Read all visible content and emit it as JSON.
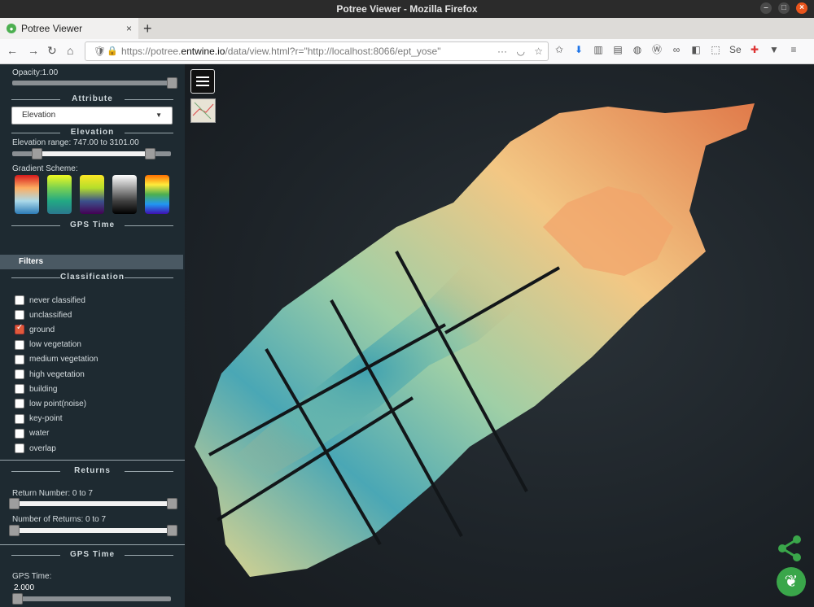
{
  "window": {
    "title": "Potree Viewer - Mozilla Firefox"
  },
  "tab": {
    "label": "Potree Viewer"
  },
  "url": {
    "prefix": "https://potree.",
    "domain": "entwine.io",
    "rest": "/data/view.html?r=\"http://localhost:8066/ept_yose\""
  },
  "sidebar": {
    "opacity_label": "Opacity:1.00",
    "attribute_title": "Attribute",
    "attribute_selected": "Elevation",
    "elevation_title": "Elevation",
    "elevation_range": "Elevation range: 747.00 to 3101.00",
    "gradient_label": "Gradient Scheme:",
    "gps_title": "GPS Time",
    "filters_label": "Filters",
    "classification_title": "Classification",
    "classes": [
      {
        "label": "never classified",
        "checked": false
      },
      {
        "label": "unclassified",
        "checked": false
      },
      {
        "label": "ground",
        "checked": true
      },
      {
        "label": "low vegetation",
        "checked": false
      },
      {
        "label": "medium vegetation",
        "checked": false
      },
      {
        "label": "high vegetation",
        "checked": false
      },
      {
        "label": "building",
        "checked": false
      },
      {
        "label": "low point(noise)",
        "checked": false
      },
      {
        "label": "key-point",
        "checked": false
      },
      {
        "label": "water",
        "checked": false
      },
      {
        "label": "overlap",
        "checked": false
      }
    ],
    "returns_title": "Returns",
    "return_number": "Return Number: 0 to 7",
    "number_of_returns": "Number of Returns: 0 to 7",
    "gps_time_title": "GPS Time",
    "gps_time_label": "GPS Time:",
    "gps_time_value": "2.000"
  },
  "icons": {
    "menu": "hamburger-icon",
    "share": "share-icon",
    "logo": "potree-logo-icon"
  }
}
